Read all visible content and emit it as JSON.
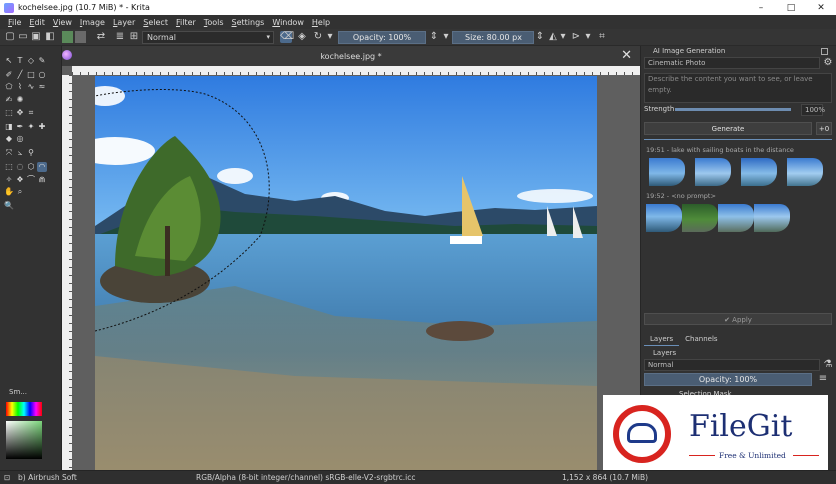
{
  "window": {
    "title": "kochelsee.jpg (10.7 MiB)  * - Krita",
    "buttons": {
      "minimize": "–",
      "maximize": "□",
      "close": "✕"
    }
  },
  "menu": [
    "File",
    "Edit",
    "View",
    "Image",
    "Layer",
    "Select",
    "Filter",
    "Tools",
    "Settings",
    "Window",
    "Help"
  ],
  "toolbar": {
    "blend_mode": "Normal",
    "opacity": "Opacity: 100%",
    "size_label": "Size:",
    "size_value": "80.00 px"
  },
  "document": {
    "tab_title": "kochelsee.jpg *"
  },
  "small_color_selector": {
    "title": "Sm..."
  },
  "ai_panel": {
    "title": "AI Image Generation",
    "style": "Cinematic Photo",
    "prompt_placeholder": "Describe the content you want to see, or leave empty.",
    "strength_label": "Strength",
    "strength_value": "100%",
    "generate_label": "Generate",
    "count": "+0",
    "history": [
      {
        "label": "19:51 - lake with sailing boats in the distance"
      },
      {
        "label": "19:52 - <no prompt>"
      }
    ],
    "apply_label": "Apply"
  },
  "layers_panel": {
    "tabs": [
      "Layers",
      "Channels"
    ],
    "title": "Layers",
    "blend_mode": "Normal",
    "opacity": "Opacity:  100%",
    "first_layer": "Selection Mask"
  },
  "statusbar": {
    "brush": "b) Airbrush Soft",
    "color_space": "RGB/Alpha (8-bit integer/channel)  sRGB-elle-V2-srgbtrc.icc",
    "dimensions": "1,152 x 864 (10.7 MiB)"
  },
  "watermark": {
    "brand": "FileGit",
    "tagline": "Free & Unlimited"
  },
  "colors": {
    "accent": "#4c6a8c",
    "watermark_red": "#d8241f",
    "watermark_blue": "#1d2f73"
  }
}
